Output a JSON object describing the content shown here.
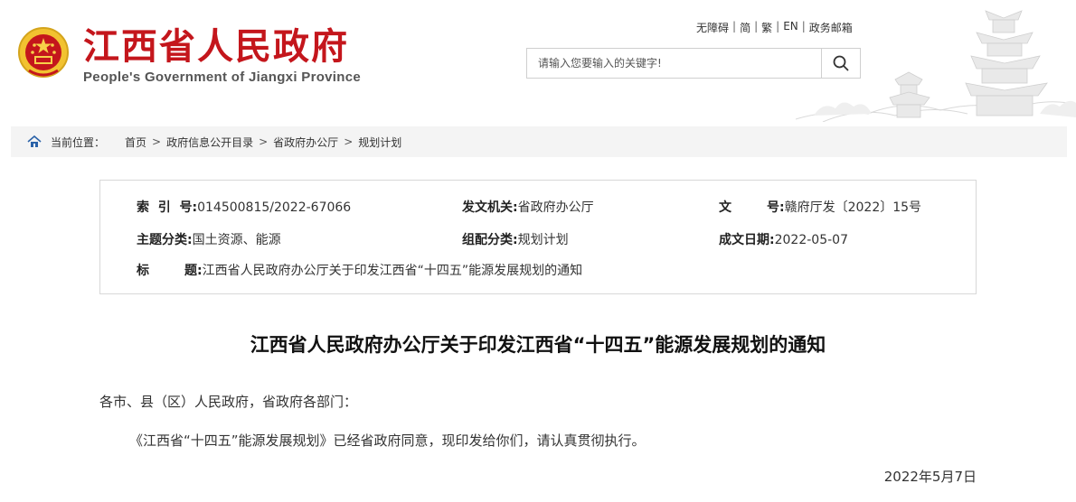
{
  "header": {
    "title": "江西省人民政府",
    "subtitle": "People's Government of Jiangxi Province",
    "top_links": [
      "无障碍",
      "简",
      "繁",
      "EN",
      "政务邮箱"
    ],
    "search_placeholder": "请输入您要输入的关键字!"
  },
  "breadcrumb": {
    "label": "当前位置：",
    "items": [
      "首页",
      "政府信息公开目录",
      "省政府办公厅",
      "规划计划"
    ]
  },
  "meta": {
    "index_key": "索  引  号:",
    "index_val": "014500815/2022-67066",
    "issuer_key": "发文机关:",
    "issuer_val": "省政府办公厅",
    "docno_key": "文        号:",
    "docno_val": "赣府厅发〔2022〕15号",
    "topic_key": "主题分类:",
    "topic_val": "国土资源、能源",
    "category_key": "组配分类:",
    "category_val": "规划计划",
    "date_key": "成文日期:",
    "date_val": "2022-05-07",
    "title_key": "标        题:",
    "title_val": "江西省人民政府办公厅关于印发江西省“十四五”能源发展规划的通知"
  },
  "article": {
    "title": "江西省人民政府办公厅关于印发江西省“十四五”能源发展规划的通知",
    "salutation": "各市、县（区）人民政府，省政府各部门：",
    "body": "《江西省“十四五”能源发展规划》已经省政府同意，现印发给你们，请认真贯彻执行。",
    "date": "2022年5月7日"
  },
  "colors": {
    "brand_red": "#c4161c",
    "breadcrumb_bg": "#f4f4f4",
    "border": "#d8d8d8"
  },
  "icons": [
    "national-emblem-icon",
    "search-icon",
    "home-icon"
  ]
}
